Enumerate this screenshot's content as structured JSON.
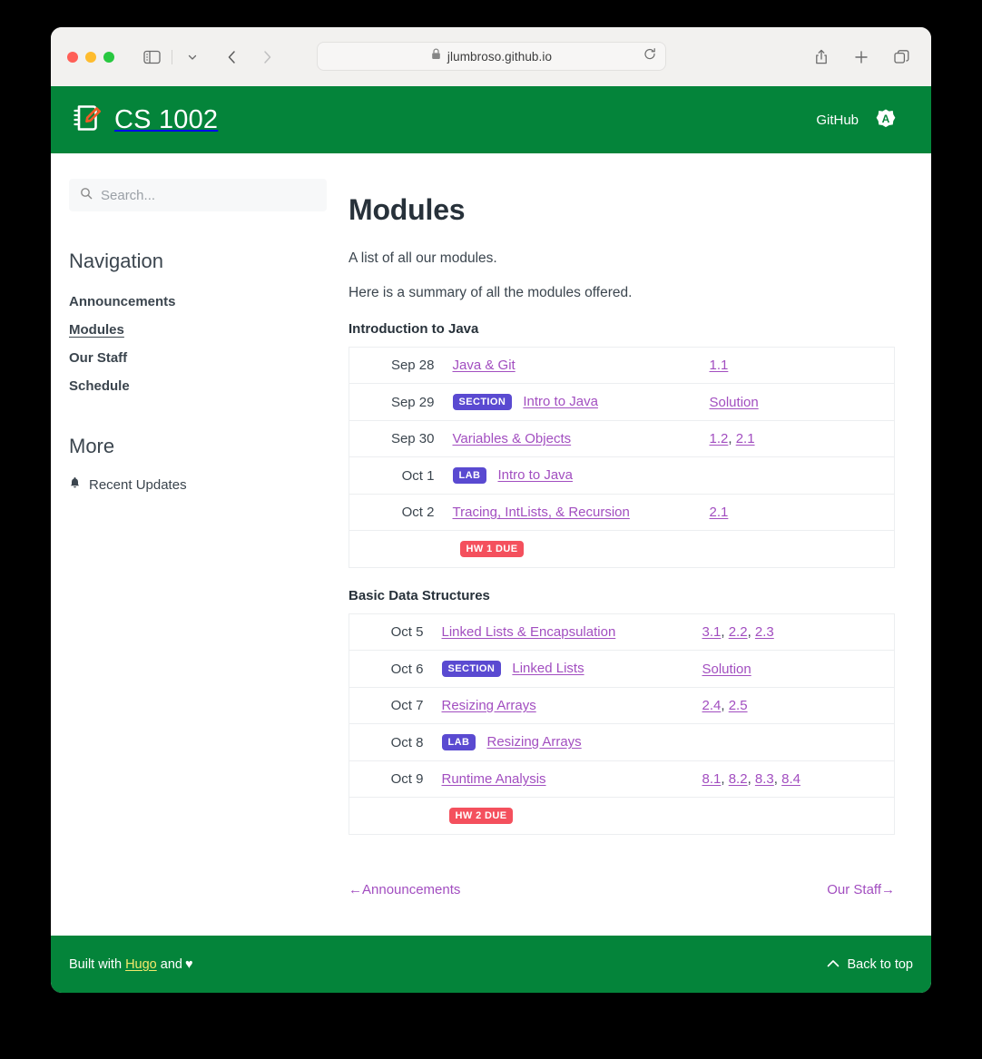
{
  "browser": {
    "url": "jlumbroso.github.io",
    "lock_icon": "lock-icon",
    "reload_icon": "reload-icon",
    "sidebar_toggle_icon": "sidebar-toggle-icon",
    "chevron_down_icon": "chevron-down-icon",
    "back_icon": "back-arrow-icon",
    "forward_icon": "forward-arrow-icon",
    "share_icon": "share-icon",
    "new_tab_icon": "plus-icon",
    "tab_overview_icon": "tab-overview-icon"
  },
  "header": {
    "title": "CS 1002",
    "logo_icon": "notebook-pencil-logo",
    "github_label": "GitHub",
    "badge_icon": "octagon-a-icon"
  },
  "search": {
    "placeholder": "Search...",
    "value": "",
    "icon": "search-icon"
  },
  "sidebar": {
    "nav_title": "Navigation",
    "items": [
      {
        "label": "Announcements",
        "active": false
      },
      {
        "label": "Modules",
        "active": true
      },
      {
        "label": "Our Staff",
        "active": false
      },
      {
        "label": "Schedule",
        "active": false
      }
    ],
    "more_title": "More",
    "more_items": [
      {
        "label": "Recent Updates",
        "icon": "bell-icon"
      }
    ]
  },
  "main": {
    "title": "Modules",
    "intro_1": "A list of all our modules.",
    "intro_2": "Here is a summary of all the modules offered.",
    "sections": [
      {
        "heading": "Introduction to Java",
        "rows": [
          {
            "date": "Sep 28",
            "badge": "",
            "badge_kind": "",
            "topic": "Java & Git",
            "readings": [
              "1.1"
            ]
          },
          {
            "date": "Sep 29",
            "badge": "SECTION",
            "badge_kind": "purple",
            "topic": "Intro to Java",
            "readings": [
              "Solution"
            ]
          },
          {
            "date": "Sep 30",
            "badge": "",
            "badge_kind": "",
            "topic": "Variables & Objects",
            "readings": [
              "1.2",
              "2.1"
            ]
          },
          {
            "date": "Oct 1",
            "badge": "LAB",
            "badge_kind": "purple",
            "topic": "Intro to Java",
            "readings": []
          },
          {
            "date": "Oct 2",
            "badge": "",
            "badge_kind": "",
            "topic": "Tracing, IntLists, & Recursion",
            "readings": [
              "2.1"
            ]
          },
          {
            "date": "",
            "badge": "HW 1 DUE",
            "badge_kind": "red",
            "topic": "",
            "readings": []
          }
        ]
      },
      {
        "heading": "Basic Data Structures",
        "rows": [
          {
            "date": "Oct 5",
            "badge": "",
            "badge_kind": "",
            "topic": "Linked Lists & Encapsulation",
            "readings": [
              "3.1",
              "2.2",
              "2.3"
            ]
          },
          {
            "date": "Oct 6",
            "badge": "SECTION",
            "badge_kind": "purple",
            "topic": "Linked Lists",
            "readings": [
              "Solution"
            ]
          },
          {
            "date": "Oct 7",
            "badge": "",
            "badge_kind": "",
            "topic": "Resizing Arrays",
            "readings": [
              "2.4",
              "2.5"
            ]
          },
          {
            "date": "Oct 8",
            "badge": "LAB",
            "badge_kind": "purple",
            "topic": "Resizing Arrays",
            "readings": []
          },
          {
            "date": "Oct 9",
            "badge": "",
            "badge_kind": "",
            "topic": "Runtime Analysis",
            "readings": [
              "8.1",
              "8.2",
              "8.3",
              "8.4"
            ]
          },
          {
            "date": "",
            "badge": "HW 2 DUE",
            "badge_kind": "red",
            "topic": "",
            "readings": []
          }
        ]
      }
    ]
  },
  "pager": {
    "prev": "←Announcements",
    "next": "Our Staff→"
  },
  "footer": {
    "built_with": "Built with",
    "hugo": "Hugo",
    "and": "and",
    "heart": "♥",
    "back_to_top": "Back to top",
    "chevron_up_icon": "chevron-up-icon"
  },
  "colors": {
    "brand_green": "#04843a",
    "link_purple": "#a24ec0",
    "badge_purple": "#5a4ad1",
    "badge_red": "#f4505d",
    "footer_link_yellow": "#f2e96b"
  }
}
